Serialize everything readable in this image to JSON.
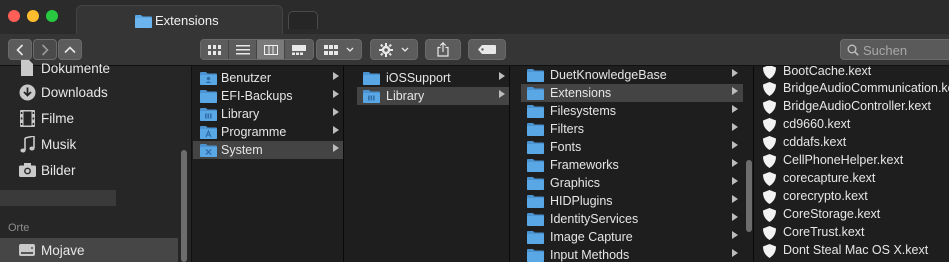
{
  "window": {
    "tab_title": "Extensions"
  },
  "toolbar": {
    "search_placeholder": "Suchen"
  },
  "sidebar": {
    "items": [
      {
        "label": "Dokumente",
        "icon": "documents-icon"
      },
      {
        "label": "Downloads",
        "icon": "downloads-icon"
      },
      {
        "label": "Filme",
        "icon": "movies-icon"
      },
      {
        "label": "Musik",
        "icon": "music-icon"
      },
      {
        "label": "Bilder",
        "icon": "pictures-icon"
      }
    ],
    "section_label": "Orte",
    "location": {
      "label": "Mojave",
      "icon": "disk-icon"
    }
  },
  "columns": {
    "col1": [
      "Benutzer",
      "EFI-Backups",
      "Library",
      "Programme",
      "System"
    ],
    "col2": [
      "iOSSupport",
      "Library"
    ],
    "col3": [
      "DuetKnowledgeBase",
      "Extensions",
      "Filesystems",
      "Filters",
      "Fonts",
      "Frameworks",
      "Graphics",
      "HIDPlugins",
      "IdentityServices",
      "Image Capture",
      "Input Methods"
    ],
    "col4": [
      "BootCache.kext",
      "BridgeAudioCommunication.kext",
      "BridgeAudioController.kext",
      "cd9660.kext",
      "cddafs.kext",
      "CellPhoneHelper.kext",
      "corecapture.kext",
      "corecrypto.kext",
      "CoreStorage.kext",
      "CoreTrust.kext",
      "Dont Steal Mac OS X.kext"
    ]
  },
  "colors": {
    "accent_folder": "#5aa7e6",
    "traffic_close": "#ff5f57",
    "traffic_min": "#febc2e",
    "traffic_max": "#28c840"
  }
}
